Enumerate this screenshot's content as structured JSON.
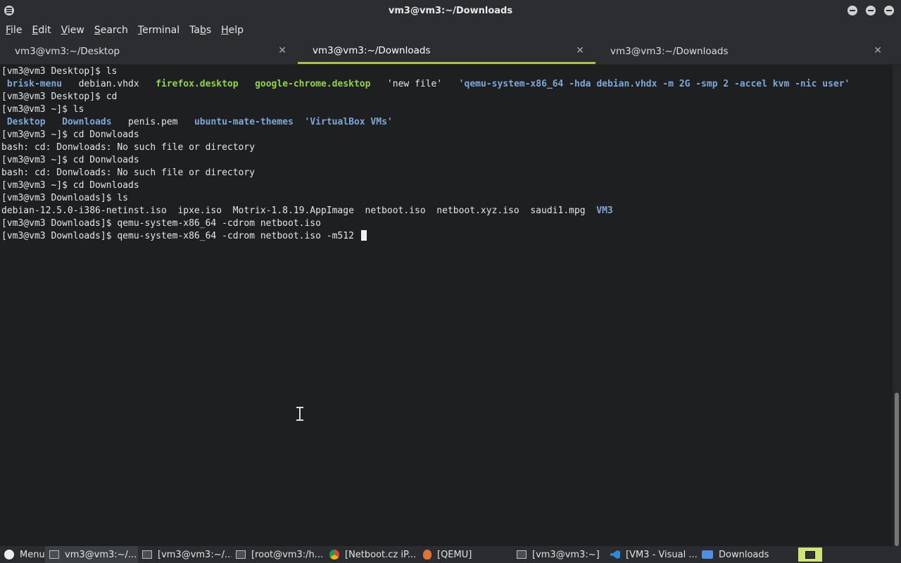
{
  "window": {
    "title": "vm3@vm3:~/Downloads"
  },
  "menu": [
    "File",
    "Edit",
    "View",
    "Search",
    "Terminal",
    "Tabs",
    "Help"
  ],
  "menu_mnemonic_index": [
    0,
    0,
    0,
    0,
    0,
    2,
    0
  ],
  "tabs": [
    {
      "label": "vm3@vm3:~/Desktop",
      "active": false
    },
    {
      "label": "vm3@vm3:~/Downloads",
      "active": true
    },
    {
      "label": "vm3@vm3:~/Downloads",
      "active": false
    }
  ],
  "terminal_lines": [
    [
      {
        "t": "[vm3@vm3 Desktop]$ ls"
      }
    ],
    [
      {
        "t": " "
      },
      {
        "t": "brisk-menu",
        "c": "dir"
      },
      {
        "t": "   debian.vhdx   "
      },
      {
        "t": "firefox.desktop",
        "c": "exe"
      },
      {
        "t": "   "
      },
      {
        "t": "google-chrome.desktop",
        "c": "exe"
      },
      {
        "t": "   'new file'   "
      },
      {
        "t": "'qemu-system-x86_64 -hda debian.vhdx -m 2G -smp 2 -accel kvm -nic user'",
        "c": "dir"
      }
    ],
    [
      {
        "t": "[vm3@vm3 Desktop]$ cd"
      }
    ],
    [
      {
        "t": "[vm3@vm3 ~]$ ls"
      }
    ],
    [
      {
        "t": " "
      },
      {
        "t": "Desktop",
        "c": "dir"
      },
      {
        "t": "   "
      },
      {
        "t": "Downloads",
        "c": "dir"
      },
      {
        "t": "   penis.pem   "
      },
      {
        "t": "ubuntu-mate-themes",
        "c": "dir"
      },
      {
        "t": "  "
      },
      {
        "t": "'VirtualBox VMs'",
        "c": "dir"
      }
    ],
    [
      {
        "t": "[vm3@vm3 ~]$ cd Donwloads"
      }
    ],
    [
      {
        "t": "bash: cd: Donwloads: No such file or directory"
      }
    ],
    [
      {
        "t": "[vm3@vm3 ~]$ cd Donwloads"
      }
    ],
    [
      {
        "t": "bash: cd: Donwloads: No such file or directory"
      }
    ],
    [
      {
        "t": "[vm3@vm3 ~]$ cd Downloads"
      }
    ],
    [
      {
        "t": "[vm3@vm3 Downloads]$ ls"
      }
    ],
    [
      {
        "t": "debian-12.5.0-i386-netinst.iso  ipxe.iso  Motrix-1.8.19.AppImage  netboot.iso  netboot.xyz.iso  saudi1.mpg  "
      },
      {
        "t": "VM3",
        "c": "dir"
      }
    ],
    [
      {
        "t": "[vm3@vm3 Downloads]$ qemu-system-x86_64 -cdrom netboot.iso"
      }
    ],
    [
      {
        "t": "[vm3@vm3 Downloads]$ qemu-system-x86_64 -cdrom netboot.iso -m512 "
      },
      {
        "cursor": true
      }
    ]
  ],
  "taskbar": [
    {
      "label": "Menu",
      "icon": "gnome-foot-icon",
      "icon_class": "gnome",
      "width": 64,
      "active": false
    },
    {
      "label": "vm3@vm3:~/...",
      "icon": "terminal-icon",
      "icon_class": "term",
      "width": 132,
      "active": true
    },
    {
      "label": "[vm3@vm3:~/...",
      "icon": "terminal-icon",
      "icon_class": "term",
      "width": 133,
      "active": false
    },
    {
      "label": "[root@vm3:/h...",
      "icon": "terminal-icon",
      "icon_class": "term",
      "width": 133,
      "active": false
    },
    {
      "label": "[Netboot.cz iP...",
      "icon": "chrome-icon",
      "icon_class": "chrome",
      "width": 133,
      "active": false
    },
    {
      "label": "[QEMU]",
      "icon": "qemu-icon",
      "icon_class": "qemu",
      "width": 133,
      "active": false
    },
    {
      "label": "[vm3@vm3:~]",
      "icon": "terminal-icon",
      "icon_class": "term",
      "width": 133,
      "active": false
    },
    {
      "label": "[VM3 - Visual ...",
      "icon": "vscode-icon",
      "icon_class": "vscode",
      "width": 130,
      "active": false
    },
    {
      "label": "Downloads",
      "icon": "folder-icon",
      "icon_class": "folder",
      "width": 130,
      "active": false
    }
  ],
  "colors": {
    "directory": "#7fa7d6",
    "executable": "#95d34a",
    "active_tab": "#a9c24f",
    "background": "#1d1f21"
  }
}
